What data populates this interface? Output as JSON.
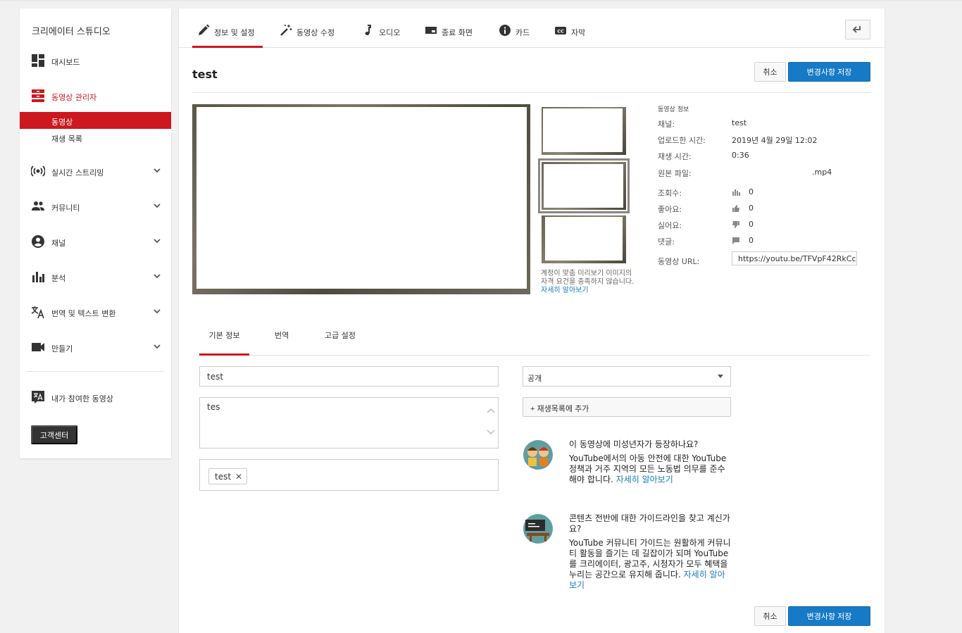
{
  "sidebar": {
    "title": "크리에이터 스튜디오",
    "dashboard": "대시보드",
    "video_manager": "동영상 관리자",
    "sub_videos": "동영상",
    "sub_playlists": "재생 목록",
    "live": "실시간 스트리밍",
    "community": "커뮤니티",
    "channel": "채널",
    "analytics": "분석",
    "translation": "번역 및 텍스트 변환",
    "create": "만들기",
    "contributed": "내가 참여한 동영상",
    "help": "고객센터"
  },
  "tabs": {
    "info": "정보 및 설정",
    "enhance": "동영상 수정",
    "audio": "오디오",
    "end_screen": "종료 화면",
    "cards": "카드",
    "subtitles": "자막"
  },
  "video": {
    "title": "test",
    "cancel": "취소",
    "save": "변경사항 저장"
  },
  "thumbnails": {
    "note": "계정이 맞춤 미리보기 이미지의 자격 요건을 충족하지 않습니다.",
    "link": "자세히 알아보기"
  },
  "info": {
    "heading": "동영상 정보",
    "channel_k": "채널:",
    "channel_v": "test",
    "uploaded_k": "업로드한 시간:",
    "uploaded_v": "2019년 4월 29일 12:02",
    "duration_k": "재생 시간:",
    "duration_v": "0:36",
    "file_k": "원본 파일:",
    "file_v": ".mp4",
    "views_k": "조회수:",
    "views_v": "0",
    "likes_k": "좋아요:",
    "likes_v": "0",
    "dislikes_k": "싫어요:",
    "dislikes_v": "0",
    "comments_k": "댓글:",
    "comments_v": "0",
    "url_k": "동영상 URL:",
    "url_v": "https://youtu.be/TFVpF42RkCc"
  },
  "subtabs": {
    "basic": "기본 정보",
    "translation": "번역",
    "advanced": "고급 설정"
  },
  "form": {
    "title_value": "test",
    "description_value": "tes",
    "tag": "test",
    "privacy": "공개",
    "add_playlist": "+ 재생목록에 추가"
  },
  "notices": {
    "minors_title": "이 동영상에 미성년자가 등장하나요?",
    "minors_body": "YouTube에서의 아동 안전에 대한 YouTube 정책과 거주 지역의 모든 노동법 의무를 준수해야 합니다.",
    "minors_link": "자세히 알아보기",
    "guidelines_title": "콘텐츠 전반에 대한 가이드라인을 찾고 계신가요?",
    "guidelines_body": "YouTube 커뮤니티 가이드는 원활하게 커뮤니티 활동을 즐기는 데 길잡이가 되며 YouTube를 크리에이터, 광고주, 시청자가 모두 혜택을 누리는 공간으로 유지해 줍니다.",
    "guidelines_link": "자세히 알아보기"
  },
  "colors": {
    "accent_red": "#cc181e",
    "save_blue": "#167ac6",
    "link_blue": "#167ac6"
  }
}
